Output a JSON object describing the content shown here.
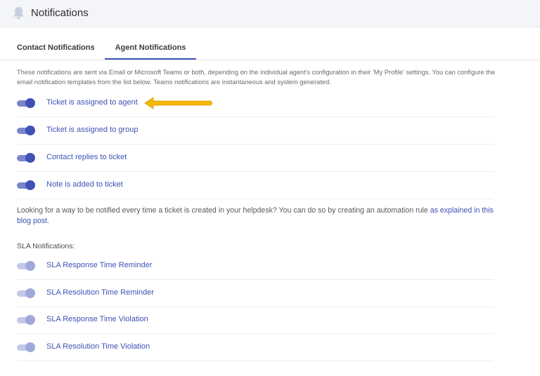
{
  "header": {
    "title": "Notifications",
    "icon": "bell-icon"
  },
  "tabs": [
    {
      "label": "Contact Notifications",
      "active": false
    },
    {
      "label": "Agent Notifications",
      "active": true
    }
  ],
  "description": "These notifications are sent via Email or Microsoft Teams or both, depending on the individual agent's configuration in their 'My Profile' settings. You can configure the email notification templates from the list below. Teams notifications are instantaneous and system generated.",
  "agent_notifications": [
    {
      "label": "Ticket is assigned to agent",
      "enabled": true
    },
    {
      "label": "Ticket is assigned to group",
      "enabled": true
    },
    {
      "label": "Contact replies to ticket",
      "enabled": true
    },
    {
      "label": "Note is added to ticket",
      "enabled": true
    }
  ],
  "info": {
    "text": "Looking for a way to be notified every time a ticket is created in your helpdesk? You can do so by creating an automation rule ",
    "link_text": "as explained in this blog post."
  },
  "sla": {
    "heading": "SLA Notifications:",
    "items": [
      {
        "label": "SLA Response Time Reminder",
        "enabled": true
      },
      {
        "label": "SLA Resolution Time Reminder",
        "enabled": true
      },
      {
        "label": "SLA Response Time Violation",
        "enabled": true
      },
      {
        "label": "SLA Resolution Time Violation",
        "enabled": true
      }
    ]
  },
  "colors": {
    "accent": "#3f51b5",
    "arrow": "#f5b800",
    "header_bg": "#f4f5f9"
  }
}
